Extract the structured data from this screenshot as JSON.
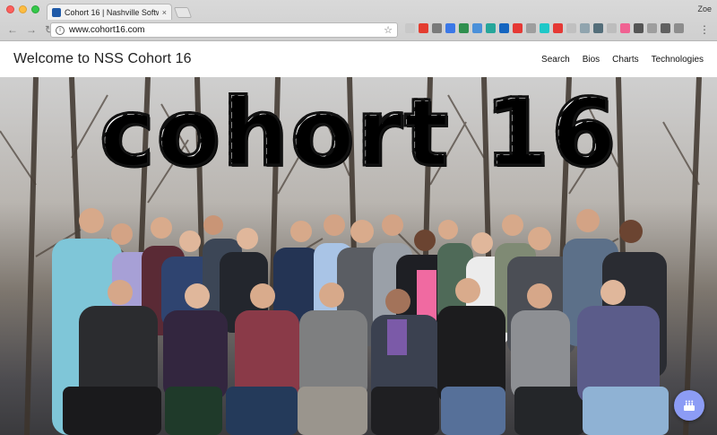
{
  "browser": {
    "tab_title": "Cohort 16 | Nashville Software",
    "tab_close": "×",
    "profile_name": "Zoe",
    "url": "www.cohort16.com",
    "back_glyph": "←",
    "forward_glyph": "→",
    "reload_glyph": "↻",
    "star_glyph": "☆",
    "menu_glyph": "⋮",
    "info_glyph": "i",
    "extension_colors": [
      "#c8c8c8",
      "#e43d30",
      "#7a7a7a",
      "#3b78e7",
      "#2f8f4e",
      "#4a90d9",
      "#26a69a",
      "#1565c0",
      "#e53935",
      "#9e9e9e",
      "#1ec8c8",
      "#e53935",
      "#c0c0c0",
      "#90a4ae",
      "#546e7a",
      "#bdbdbd",
      "#f06292",
      "#555555",
      "#9e9e9e",
      "#616161",
      "#8d8d8d"
    ]
  },
  "navbar": {
    "brand": "Welcome to NSS Cohort 16",
    "links": [
      "Search",
      "Bios",
      "Charts",
      "Technologies"
    ]
  },
  "hero": {
    "title": "cohort 16",
    "photo_description_icon": "group-photo",
    "fab_icon": "birthday-cake-icon",
    "fab_color": "#8c9cf5"
  }
}
